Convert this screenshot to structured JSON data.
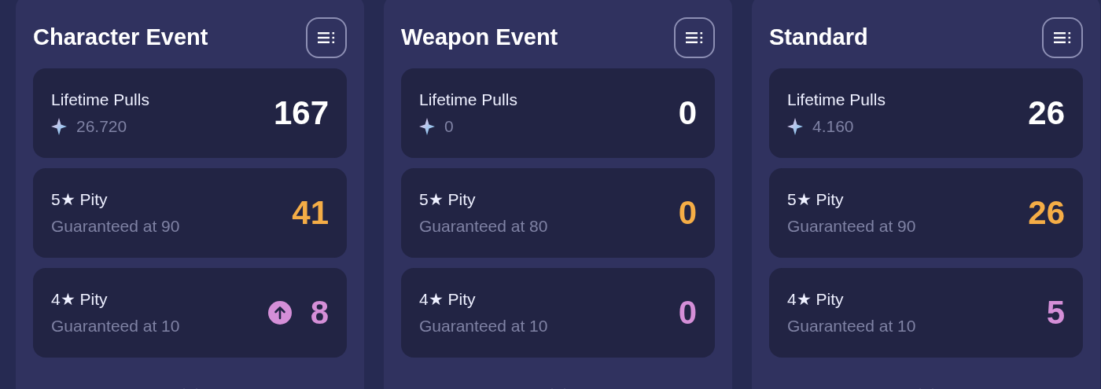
{
  "panels": [
    {
      "title": "Character Event",
      "rows": [
        {
          "kind": "total",
          "label": "Lifetime Pulls",
          "detail": "26.720",
          "value": "167",
          "indicator": false
        },
        {
          "kind": "five_star",
          "label": "5★ Pity",
          "detail": "Guaranteed at 90",
          "value": "41",
          "indicator": false
        },
        {
          "kind": "four_star",
          "label": "4★ Pity",
          "detail": "Guaranteed at 10",
          "value": "8",
          "indicator": true
        }
      ]
    },
    {
      "title": "Weapon Event",
      "rows": [
        {
          "kind": "total",
          "label": "Lifetime Pulls",
          "detail": "0",
          "value": "0",
          "indicator": false
        },
        {
          "kind": "five_star",
          "label": "5★ Pity",
          "detail": "Guaranteed at 80",
          "value": "0",
          "indicator": false
        },
        {
          "kind": "four_star",
          "label": "4★ Pity",
          "detail": "Guaranteed at 10",
          "value": "0",
          "indicator": false
        }
      ]
    },
    {
      "title": "Standard",
      "rows": [
        {
          "kind": "total",
          "label": "Lifetime Pulls",
          "detail": "4.160",
          "value": "26",
          "indicator": false
        },
        {
          "kind": "five_star",
          "label": "5★ Pity",
          "detail": "Guaranteed at 90",
          "value": "26",
          "indicator": false
        },
        {
          "kind": "four_star",
          "label": "4★ Pity",
          "detail": "Guaranteed at 10",
          "value": "5",
          "indicator": false
        }
      ]
    }
  ]
}
